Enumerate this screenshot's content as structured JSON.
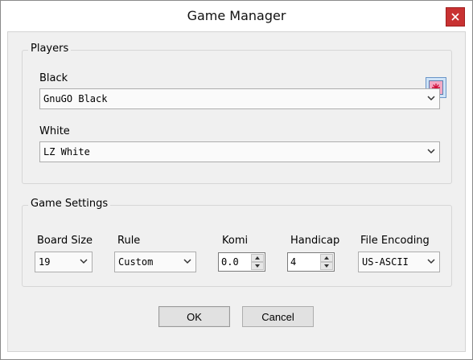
{
  "window": {
    "title": "Game Manager",
    "close_icon": "close-icon"
  },
  "players": {
    "group_label": "Players",
    "black_label": "Black",
    "black_value": "GnuGO Black",
    "white_label": "White",
    "white_value": "LZ White",
    "swap_icon": "asterisk-icon"
  },
  "settings": {
    "group_label": "Game Settings",
    "board_size_label": "Board Size",
    "board_size_value": "19",
    "rule_label": "Rule",
    "rule_value": "Custom",
    "komi_label": "Komi",
    "komi_value": "0.0",
    "handicap_label": "Handicap",
    "handicap_value": "4",
    "encoding_label": "File Encoding",
    "encoding_value": "US-ASCII"
  },
  "buttons": {
    "ok_label": "OK",
    "cancel_label": "Cancel"
  },
  "colors": {
    "close_button": "#c83232",
    "dialog_bg": "#f0f0f0",
    "swap_icon_fill": "#f2a9c4"
  }
}
